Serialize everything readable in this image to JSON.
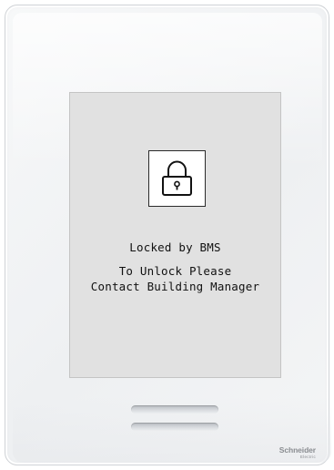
{
  "screen": {
    "icon": "padlock-icon",
    "status_line": "Locked by BMS",
    "instruction_line_1": "To Unlock Please",
    "instruction_line_2": "Contact Building Manager"
  },
  "device": {
    "brand_name": "Schneider",
    "brand_subtitle": "Electric"
  },
  "colors": {
    "screen_background": "#e1e1e1",
    "text": "#111111",
    "device_body": "#f2f3f4"
  }
}
